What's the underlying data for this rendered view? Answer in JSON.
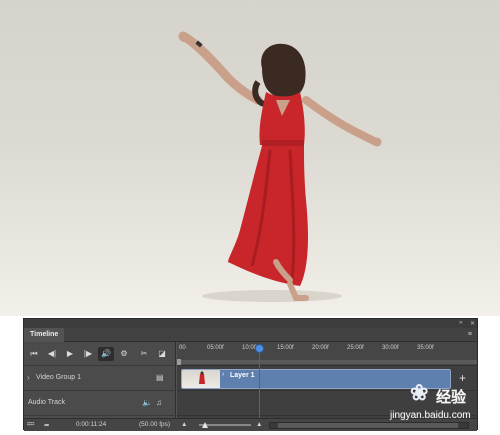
{
  "panel": {
    "tab_title": "Timeline",
    "collapse_glyph": "››",
    "close_glyph": "✕",
    "menu_glyph": "≡"
  },
  "controls": {
    "go_first_icon": "⏮",
    "step_back_icon": "◀|",
    "play_icon": "▶",
    "step_forward_icon": "|▶",
    "audio_icon": "🔊",
    "settings_icon": "⚙",
    "split_icon": "✂",
    "transition_icon": "◪"
  },
  "ruler": {
    "ticks": [
      "00",
      "05:00f",
      "10:00f",
      "15:00f",
      "20:00f",
      "25:00f",
      "30:00f",
      "35:00f"
    ]
  },
  "tracks": [
    {
      "name": "Video Group 1",
      "icon": "film-strip"
    },
    {
      "name": "Audio Track",
      "icon": "music-note"
    }
  ],
  "clip": {
    "label": "Layer 1"
  },
  "footer": {
    "timecode": "0:00:11:24",
    "fps": "(50.00 fps)"
  },
  "watermark": {
    "brand": "经验",
    "url": "jingyan.baidu.com"
  },
  "colors": {
    "panel_bg": "#535353",
    "clip_blue": "#5f7fae",
    "playhead_red": "#c43a2e",
    "playhead_knob": "#4d8fe0",
    "dress_red": "#c8262a"
  }
}
